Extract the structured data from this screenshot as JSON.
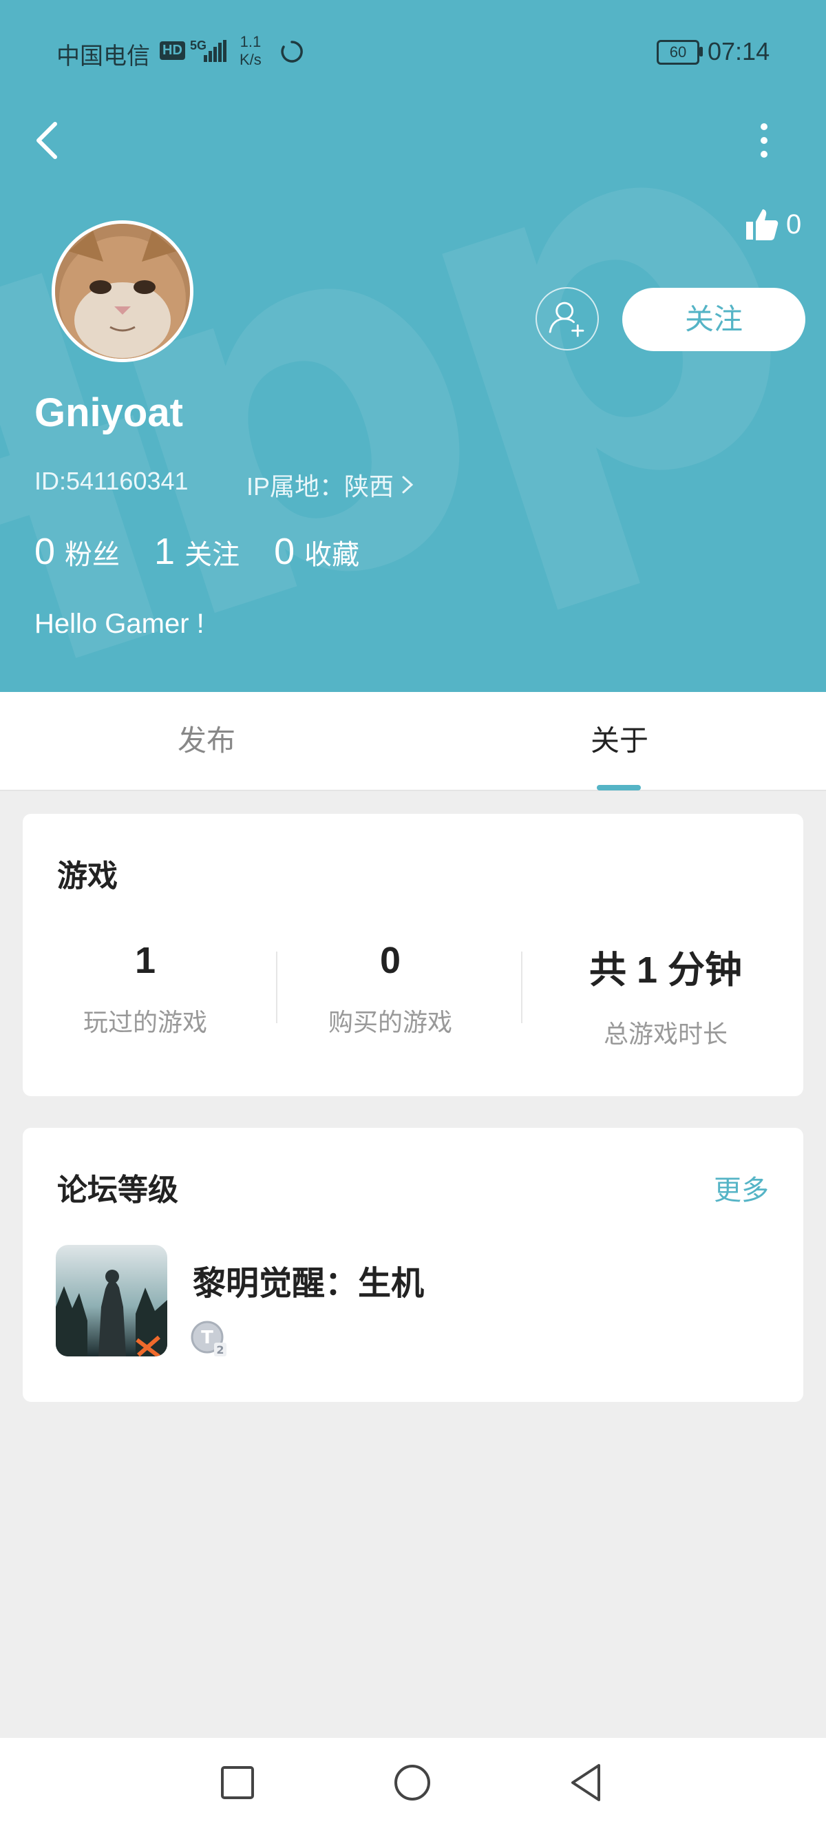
{
  "status_bar": {
    "carrier": "中国电信",
    "hd": "HD",
    "network": "5G",
    "speed_value": "1.1",
    "speed_unit": "K/s",
    "battery": "60",
    "time": "07:14"
  },
  "header": {
    "like_count": "0",
    "follow_label": "关注",
    "username": "Gniyoat",
    "user_id": "ID:541160341",
    "ip_location": "IP属地：陕西",
    "stats": [
      {
        "value": "0",
        "label": "粉丝"
      },
      {
        "value": "1",
        "label": "关注"
      },
      {
        "value": "0",
        "label": "收藏"
      }
    ],
    "bio": "Hello Gamer !",
    "accent_color": "#55b4c6"
  },
  "tabs": [
    {
      "label": "发布",
      "active": false
    },
    {
      "label": "关于",
      "active": true
    }
  ],
  "games_card": {
    "title": "游戏",
    "metrics": [
      {
        "value": "1",
        "label": "玩过的游戏"
      },
      {
        "value": "0",
        "label": "购买的游戏"
      },
      {
        "value": "共 1 分钟",
        "label": "总游戏时长"
      }
    ]
  },
  "forum_card": {
    "title": "论坛等级",
    "more_label": "更多",
    "game_name": "黎明觉醒：生机",
    "level_badge_icon": "level-t2-badge"
  },
  "icons": {
    "back": "chevron-left-icon",
    "more": "more-vertical-icon",
    "like": "thumbs-up-icon",
    "add_friend": "add-user-icon",
    "nav_recent": "square-icon",
    "nav_home": "circle-icon",
    "nav_back": "triangle-back-icon"
  }
}
